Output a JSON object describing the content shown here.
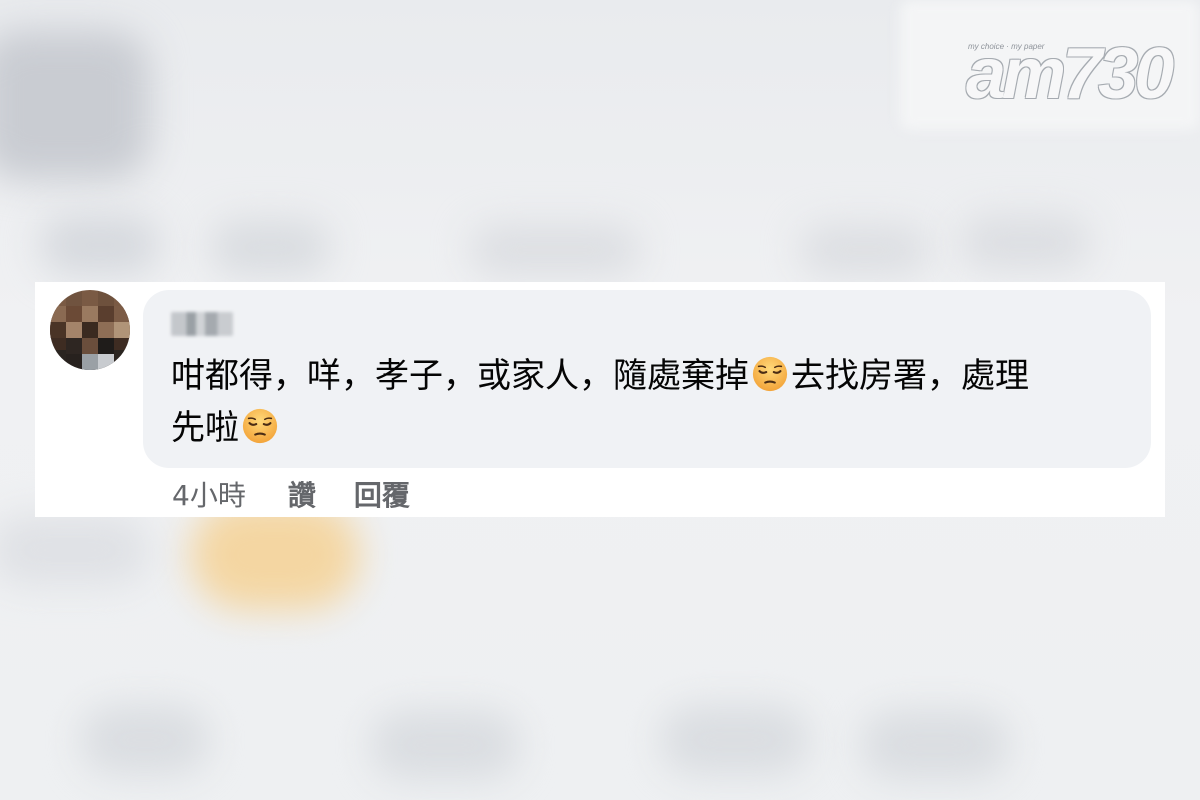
{
  "watermark": {
    "tagline": "my choice · my paper",
    "brand": "am730"
  },
  "comment": {
    "author": "███",
    "text_part1": "咁都得，咩，孝子，或家人，隨處棄掉",
    "emoji": "pensive-face",
    "text_part2": "去找房署，處理",
    "text_part3": "先啦",
    "timestamp": "4小時",
    "like_label": "讚",
    "reply_label": "回覆"
  },
  "colors": {
    "bubble": "#f0f2f5",
    "text": "#050505",
    "meta": "#65676b"
  }
}
